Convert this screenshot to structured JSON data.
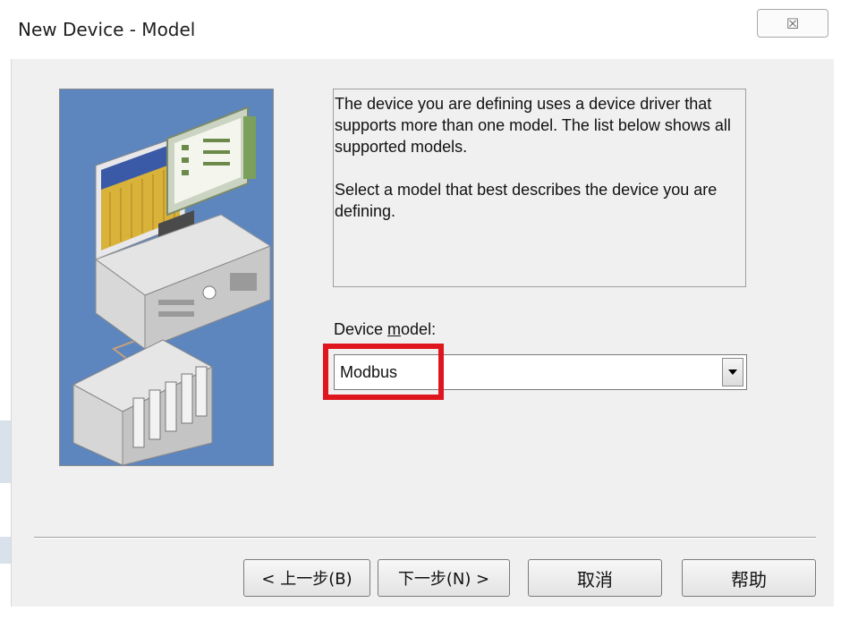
{
  "window": {
    "title": "New Device - Model",
    "close_icon": "close-icon",
    "close_glyph": "☒"
  },
  "description": {
    "paragraph1": "The device you are defining uses a device driver that supports more than one model.  The list below shows all supported models.",
    "paragraph2": "Select  a model that best describes the device you are defining."
  },
  "device_model": {
    "label_prefix": "Device ",
    "label_underlined": "m",
    "label_suffix": "odel:",
    "selected_value": "Modbus",
    "dropdown_icon": "dropdown-arrow-icon"
  },
  "illustration": {
    "icon": "pc-and-plc-illustration",
    "background_color": "#5d86be"
  },
  "buttons": {
    "back_label": "< 上一步(B)",
    "next_label": "下一步(N) >",
    "cancel_label": "取消",
    "help_label": "帮助"
  },
  "colors": {
    "highlight": "#e0161e",
    "dialog_background": "#f0f0f0"
  }
}
